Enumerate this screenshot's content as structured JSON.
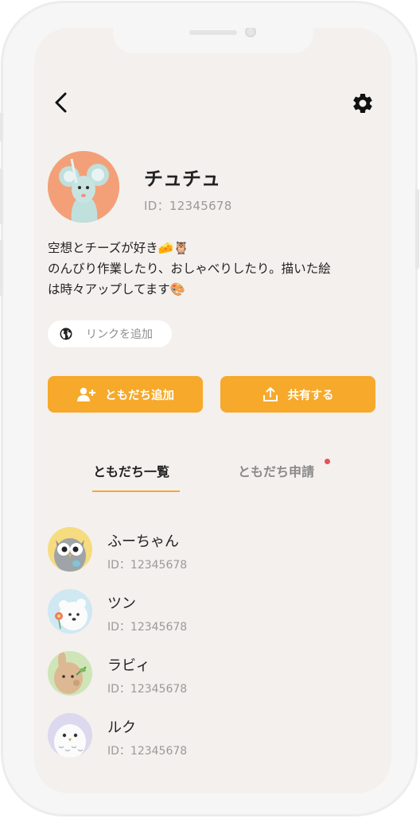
{
  "header": {
    "back_icon": "chevron-left-icon",
    "settings_icon": "gear-icon"
  },
  "profile": {
    "name": "チュチュ",
    "id_text": "ID：12345678",
    "bio_lines": [
      "空想とチーズが好き🧀🦉",
      "のんびり作業したり、おしゃべりしたり。描いた絵",
      "は時々アップしてます🎨"
    ],
    "link_label": "リンクを追加",
    "link_icon": "globe-icon"
  },
  "actions": {
    "add_friend_label": "ともだち追加",
    "add_friend_icon": "add-user-icon",
    "share_label": "共有する",
    "share_icon": "share-icon"
  },
  "tabs": {
    "friends_label": "ともだち一覧",
    "requests_label": "ともだち申請",
    "requests_has_notification": true
  },
  "friends": [
    {
      "name": "ふーちゃん",
      "id_text": "ID：12345678",
      "avatar": "owl-avatar"
    },
    {
      "name": "ツン",
      "id_text": "ID：12345678",
      "avatar": "bear-avatar"
    },
    {
      "name": "ラビィ",
      "id_text": "ID：12345678",
      "avatar": "rabbit-avatar"
    },
    {
      "name": "ルク",
      "id_text": "ID：12345678",
      "avatar": "snowy-owl-avatar"
    }
  ],
  "colors": {
    "accent": "#f6a92a",
    "screen_bg": "#f3f0ee",
    "notification_dot": "#e8505b",
    "avatar_main_bg": "#f3a078"
  }
}
